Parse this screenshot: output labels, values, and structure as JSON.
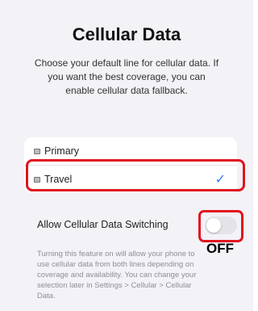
{
  "page": {
    "title": "Cellular Data",
    "subtitle": "Choose your default line for cellular data. If you want the best coverage, you can enable cellular data fallback."
  },
  "lines": [
    {
      "label": "Primary",
      "selected": false
    },
    {
      "label": "Travel",
      "selected": true
    }
  ],
  "checkmark": "✓",
  "switching": {
    "label": "Allow Cellular Data Switching",
    "state": false,
    "annotation": "OFF",
    "footnote": "Turning this feature on will allow your phone to use cellular data from both lines depending on coverage and availability. You can change your selection later in Settings > Cellular > Cellular Data."
  },
  "colors": {
    "accent": "#2f7cf6",
    "highlight": "#e0141e",
    "background": "#f2f2f7"
  }
}
